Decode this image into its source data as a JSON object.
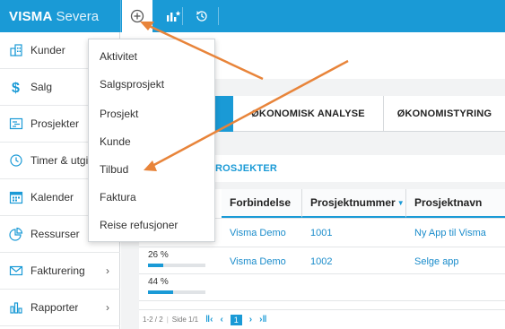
{
  "app": {
    "brand_strong": "VISMA",
    "brand_light": "Severa"
  },
  "colors": {
    "brand_blue": "#1a9ad6",
    "link_blue": "#1a8ccb",
    "annotation_arrow": "#e8843a"
  },
  "topbar": {
    "icons": [
      "plus-circle-icon",
      "analytics-star-icon",
      "history-icon"
    ]
  },
  "sidebar": {
    "items": [
      {
        "label": "Kunder",
        "icon": "building-icon",
        "has_chevron": false
      },
      {
        "label": "Salg",
        "icon": "dollar-icon",
        "has_chevron": false
      },
      {
        "label": "Prosjekter",
        "icon": "project-board-icon",
        "has_chevron": false
      },
      {
        "label": "Timer & utgi",
        "icon": "clock-icon",
        "has_chevron": false
      },
      {
        "label": "Kalender",
        "icon": "calendar-icon",
        "has_chevron": false
      },
      {
        "label": "Ressurser",
        "icon": "pie-chart-icon",
        "has_chevron": false
      },
      {
        "label": "Fakturering",
        "icon": "envelope-icon",
        "has_chevron": true
      },
      {
        "label": "Rapporter",
        "icon": "bar-chart-icon",
        "has_chevron": true
      }
    ]
  },
  "dropdown": {
    "items": [
      "Aktivitet",
      "Salgsprosjekt",
      "Prosjekt",
      "Kunde",
      "Tilbud",
      "Faktura",
      "Reise refusjoner"
    ]
  },
  "tabs": [
    "ØKONOMISK ANALYSE",
    "ØKONOMISTYRING"
  ],
  "section": {
    "title": "ROSJEKTER"
  },
  "table": {
    "columns": [
      "Forbindelse",
      "Prosjektnummer",
      "Prosjektnavn"
    ],
    "rows": [
      {
        "progress_label": "",
        "progress": 0,
        "forbindelse": "Visma Demo",
        "prosjektnummer": "1001",
        "prosjektnavn": "Ny App til Visma"
      },
      {
        "progress_label": "26 %",
        "progress": 0.26,
        "forbindelse": "Visma Demo",
        "prosjektnummer": "1002",
        "prosjektnavn": "Selge app"
      },
      {
        "progress_label": "44 %",
        "progress": 0.44,
        "forbindelse": "",
        "prosjektnummer": "",
        "prosjektnavn": ""
      }
    ]
  },
  "pager": {
    "range": "1-2 / 2",
    "page_info": "Side 1/1",
    "current_page": "1"
  }
}
